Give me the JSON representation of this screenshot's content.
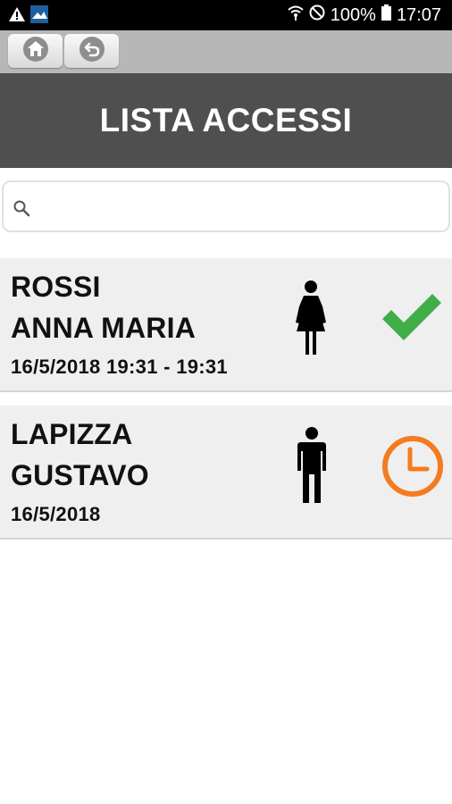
{
  "statusbar": {
    "battery_text": "100%",
    "time": "17:07",
    "icons": [
      "warning-icon",
      "app-icon",
      "wifi-icon",
      "do-not-disturb-icon",
      "battery-icon"
    ]
  },
  "toolbar": {
    "buttons": [
      "home-icon",
      "back-icon"
    ]
  },
  "header": {
    "title": "LISTA ACCESSI"
  },
  "search": {
    "value": "",
    "placeholder": ""
  },
  "colors": {
    "header_bg": "#4f4f4f",
    "toolbar_bg": "#b7b7b7",
    "row_bg": "#efefef",
    "check": "#3fae49",
    "pending": "#f47b20"
  },
  "accessi": [
    {
      "surname": "ROSSI",
      "firstname": "ANNA MARIA",
      "date": "16/5/2018 19:31 - 19:31",
      "gender_icon": "female-icon",
      "status_icon": "check-icon"
    },
    {
      "surname": "LAPIZZA",
      "firstname": "GUSTAVO",
      "date": "16/5/2018",
      "gender_icon": "male-icon",
      "status_icon": "clock-icon"
    }
  ]
}
